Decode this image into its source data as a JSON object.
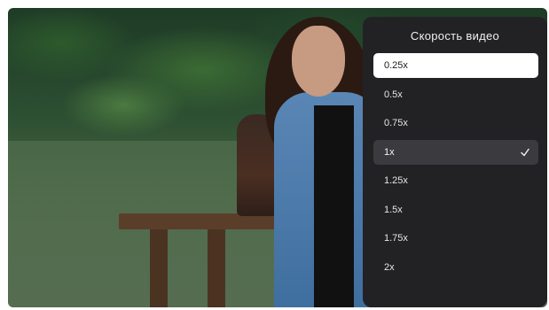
{
  "speed_menu": {
    "title": "Скорость видео",
    "options": [
      {
        "label": "0.25x",
        "state": "focused"
      },
      {
        "label": "0.5x",
        "state": "normal"
      },
      {
        "label": "0.75x",
        "state": "normal"
      },
      {
        "label": "1x",
        "state": "selected"
      },
      {
        "label": "1.25x",
        "state": "normal"
      },
      {
        "label": "1.5x",
        "state": "normal"
      },
      {
        "label": "1.75x",
        "state": "normal"
      },
      {
        "label": "2x",
        "state": "normal"
      }
    ],
    "selected_icon": "check-icon"
  },
  "colors": {
    "panel_background": "#222225",
    "focused_background": "#ffffff",
    "selected_background": "#3b3b3f"
  }
}
